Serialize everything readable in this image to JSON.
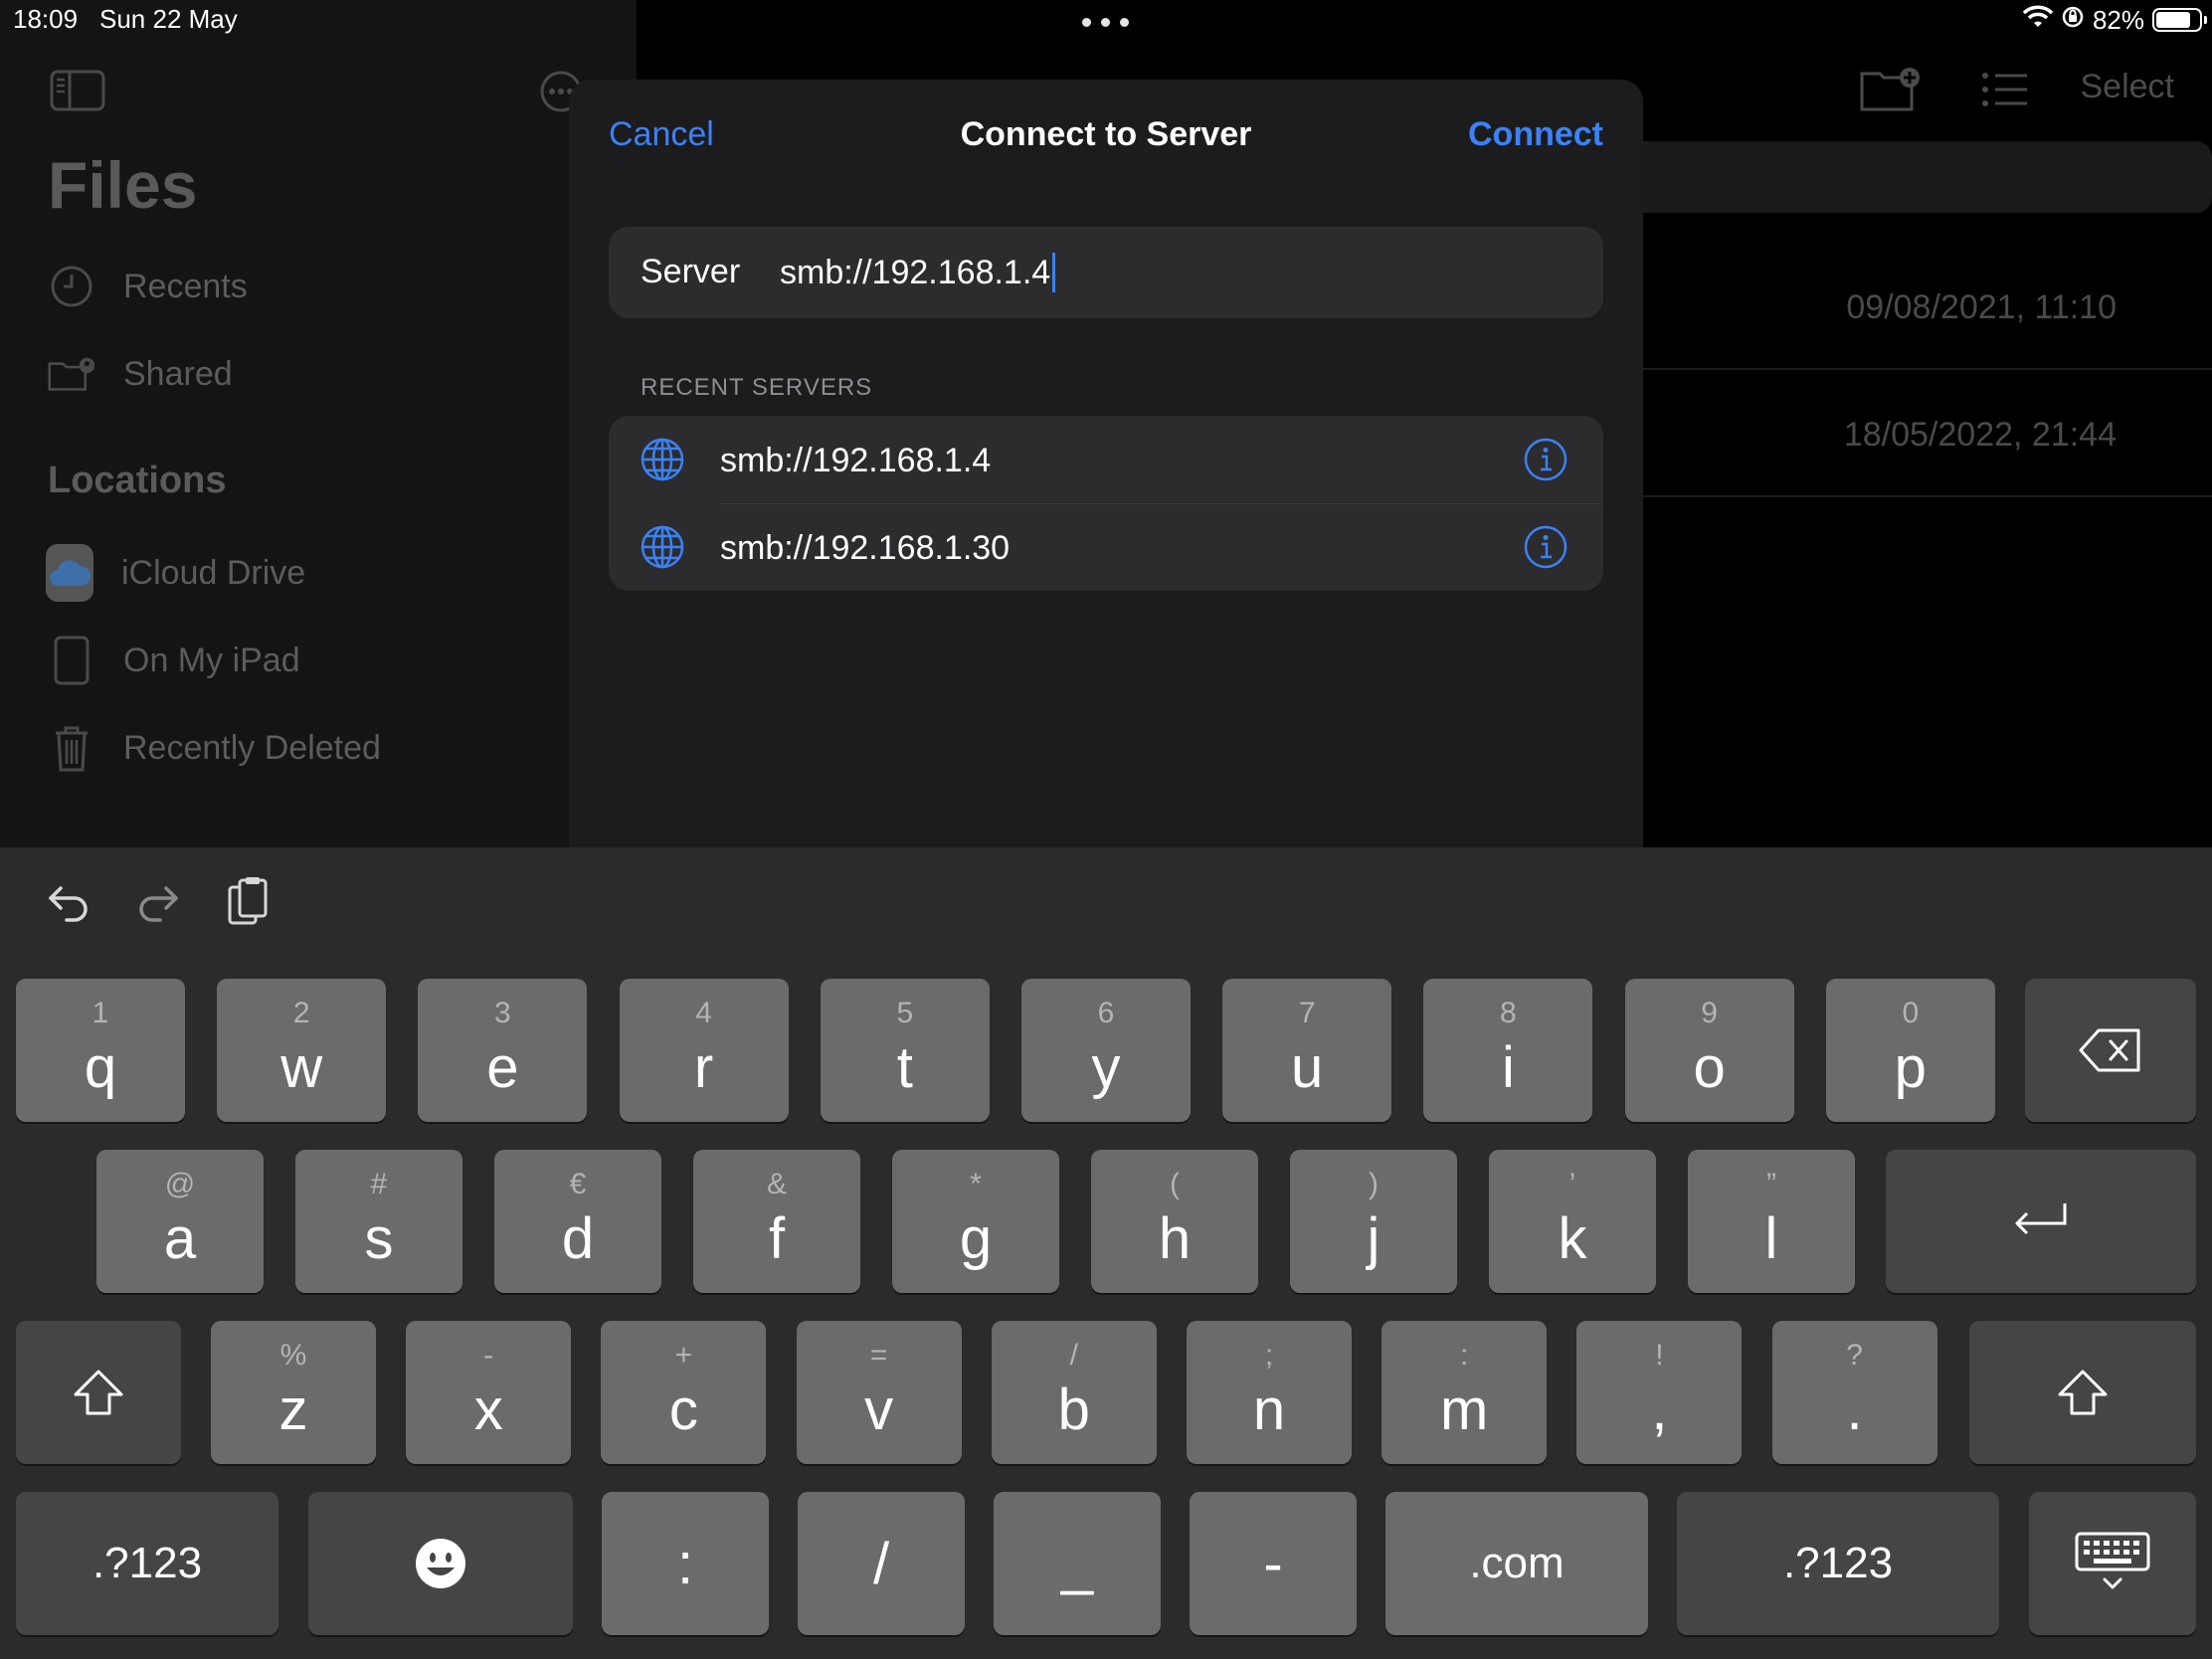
{
  "status": {
    "time": "18:09",
    "date": "Sun 22 May",
    "battery": "82%",
    "battery_level": 0.82
  },
  "sidebar": {
    "title": "Files",
    "items": [
      {
        "label": "Recents",
        "icon": "clock-icon"
      },
      {
        "label": "Shared",
        "icon": "shared-folder-icon"
      }
    ],
    "locations_heading": "Locations",
    "locations": [
      {
        "label": "iCloud Drive",
        "icon": "icloud-icon"
      },
      {
        "label": "On My iPad",
        "icon": "ipad-icon"
      },
      {
        "label": "Recently Deleted",
        "icon": "trash-icon"
      }
    ]
  },
  "content": {
    "select_label": "Select",
    "rows": [
      {
        "date": "09/08/2021, 11:10"
      },
      {
        "date": "18/05/2022, 21:44"
      }
    ]
  },
  "modal": {
    "cancel_label": "Cancel",
    "title": "Connect to Server",
    "connect_label": "Connect",
    "server_label": "Server",
    "server_value": "smb://192.168.1.4",
    "recent_heading": "RECENT SERVERS",
    "recent_servers": [
      {
        "address": "smb://192.168.1.4"
      },
      {
        "address": "smb://192.168.1.30"
      }
    ]
  },
  "keyboard": {
    "row1": [
      {
        "hint": "1",
        "key": "q"
      },
      {
        "hint": "2",
        "key": "w"
      },
      {
        "hint": "3",
        "key": "e"
      },
      {
        "hint": "4",
        "key": "r"
      },
      {
        "hint": "5",
        "key": "t"
      },
      {
        "hint": "6",
        "key": "y"
      },
      {
        "hint": "7",
        "key": "u"
      },
      {
        "hint": "8",
        "key": "i"
      },
      {
        "hint": "9",
        "key": "o"
      },
      {
        "hint": "0",
        "key": "p"
      }
    ],
    "row2": [
      {
        "hint": "@",
        "key": "a"
      },
      {
        "hint": "#",
        "key": "s"
      },
      {
        "hint": "€",
        "key": "d"
      },
      {
        "hint": "&",
        "key": "f"
      },
      {
        "hint": "*",
        "key": "g"
      },
      {
        "hint": "(",
        "key": "h"
      },
      {
        "hint": ")",
        "key": "j"
      },
      {
        "hint": "’",
        "key": "k"
      },
      {
        "hint": "”",
        "key": "l"
      }
    ],
    "row3": [
      {
        "hint": "%",
        "key": "z"
      },
      {
        "hint": "-",
        "key": "x"
      },
      {
        "hint": "+",
        "key": "c"
      },
      {
        "hint": "=",
        "key": "v"
      },
      {
        "hint": "/",
        "key": "b"
      },
      {
        "hint": ";",
        "key": "n"
      },
      {
        "hint": ":",
        "key": "m"
      },
      {
        "hint": "!",
        "key": ","
      },
      {
        "hint": "?",
        "key": "."
      }
    ],
    "row4": {
      "numbers_left": ".?123",
      "colon": ":",
      "slash": "/",
      "underscore": "_",
      "dash": "-",
      "dotcom": ".com",
      "numbers_right": ".?123"
    }
  },
  "colors": {
    "accent": "#3b82f6",
    "modal_bg": "#1c1c1e",
    "field_bg": "#2c2c2e",
    "keyboard_bg": "#2b2b2b",
    "key_bg": "#6b6b6b",
    "special_key_bg": "#454545"
  }
}
